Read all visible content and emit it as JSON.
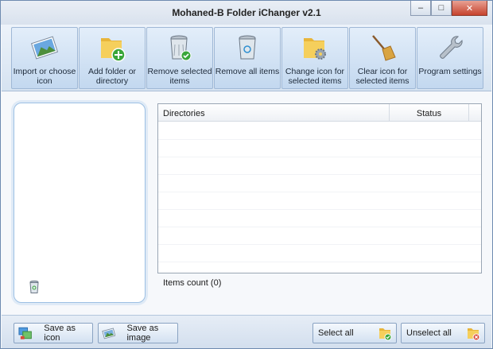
{
  "window": {
    "title": "Mohaned-B Folder iChanger v2.1",
    "controls": {
      "minimize": "‒",
      "maximize": "□",
      "close": "✕"
    }
  },
  "toolbar": {
    "items": [
      {
        "label": "Import or choose icon",
        "icon": "picture-icon"
      },
      {
        "label": "Add folder or directory",
        "icon": "add-folder-icon"
      },
      {
        "label": "Remove selected items",
        "icon": "recycle-bin-check-icon"
      },
      {
        "label": "Remove all items",
        "icon": "recycle-bin-icon"
      },
      {
        "label": "Change icon for selected items",
        "icon": "folder-gear-icon"
      },
      {
        "label": "Clear icon for selected items",
        "icon": "broom-icon"
      },
      {
        "label": "Program settings",
        "icon": "wrench-icon"
      }
    ]
  },
  "list": {
    "columns": [
      "Directories",
      "Status"
    ],
    "rows": [],
    "items_count": "Items count (0)"
  },
  "bottom": {
    "save_as_icon": "Save as icon",
    "save_as_image": "Save as image",
    "select_all": "Select all",
    "unselect_all": "Unselect all"
  },
  "colors": {
    "accent": "#c3d8ef",
    "folder": "#f2c548",
    "check": "#3aa63a",
    "close": "#c6422d"
  }
}
